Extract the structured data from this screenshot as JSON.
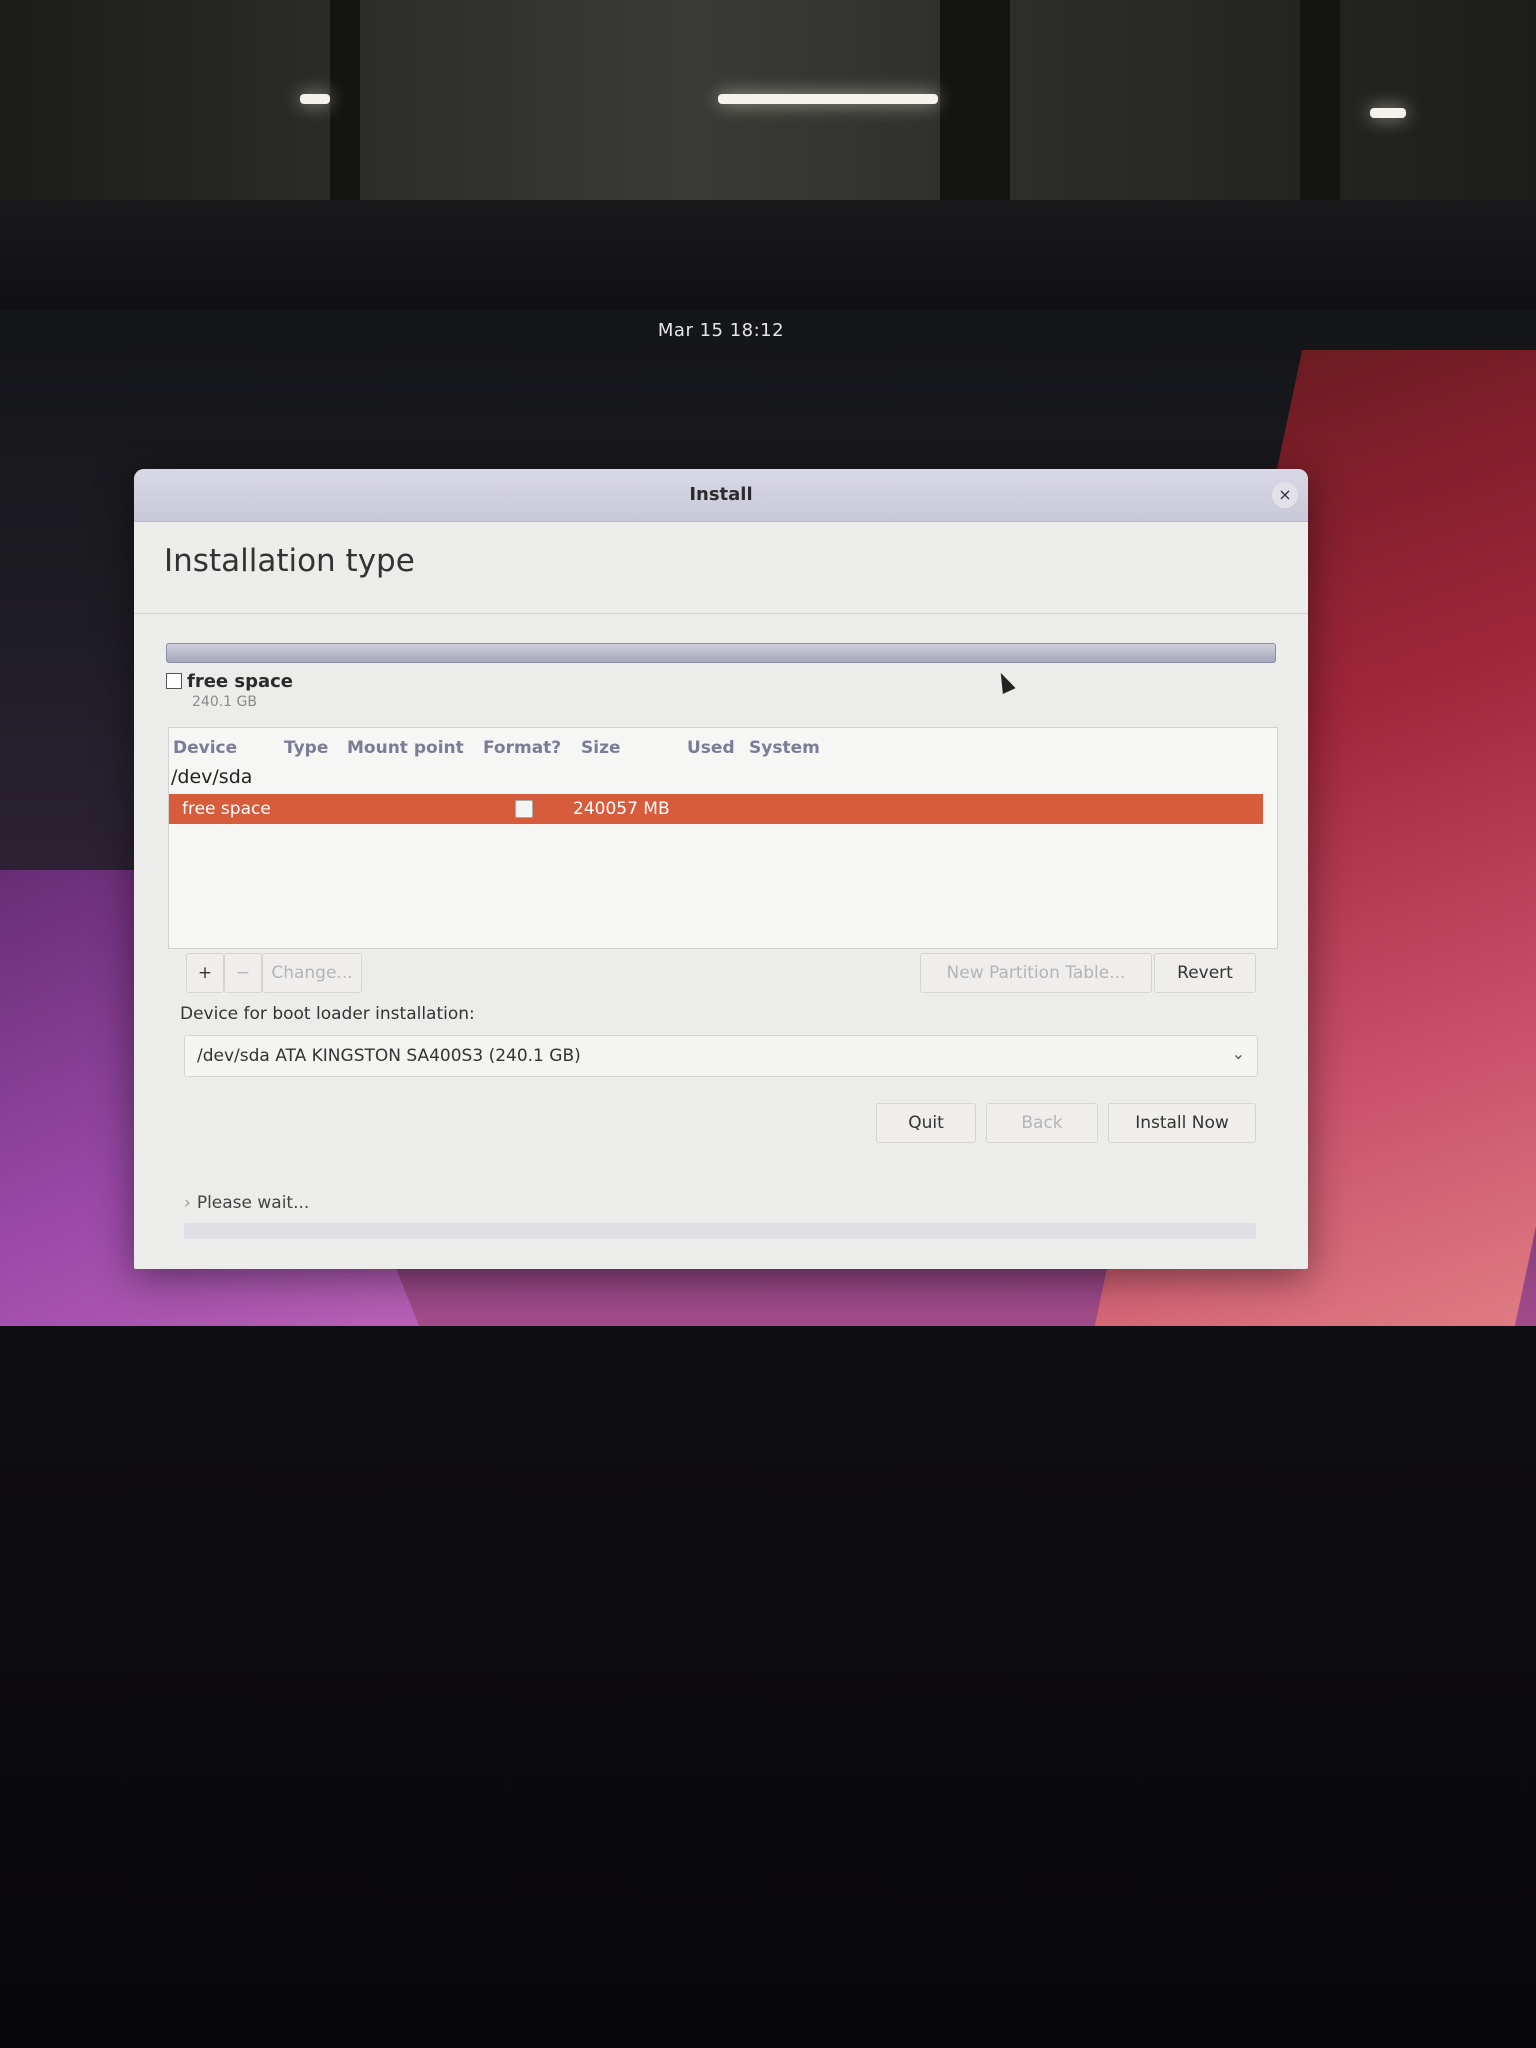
{
  "top_bar": {
    "clock": "Mar 15  18:12"
  },
  "window": {
    "title": "Install",
    "close_glyph": "×",
    "heading": "Installation type"
  },
  "disk_legend": {
    "name": "free space",
    "size": "240.1 GB"
  },
  "partition_table": {
    "columns": [
      "Device",
      "Type",
      "Mount point",
      "Format?",
      "Size",
      "Used",
      "System"
    ],
    "device_group": "/dev/sda",
    "rows": [
      {
        "device": "free space",
        "type": "",
        "mount_point": "",
        "format": false,
        "size": "240057 MB",
        "used": "",
        "system": ""
      }
    ]
  },
  "table_actions": {
    "add": "+",
    "remove": "−",
    "change": "Change...",
    "new_partition_table": "New Partition Table...",
    "revert": "Revert"
  },
  "boot_loader": {
    "label": "Device for boot loader installation:",
    "selected": "/dev/sda   ATA KINGSTON SA400S3 (240.1 GB)"
  },
  "navigation": {
    "quit": "Quit",
    "back": "Back",
    "install_now": "Install Now"
  },
  "status": {
    "text": "Please wait..."
  },
  "icons": {
    "close": "close-icon",
    "checkbox": "checkbox-icon",
    "chevron": "chevron-down-icon",
    "expander": "expander-arrow-icon"
  },
  "colors": {
    "selection": "#d75c3c",
    "window_bg": "#ececea",
    "header_text": "#7b7d96"
  }
}
